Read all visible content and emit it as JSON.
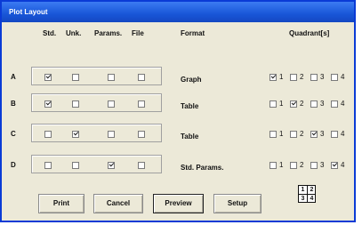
{
  "window": {
    "title": "Plot Layout"
  },
  "headers": {
    "std": "Std.",
    "unk": "Unk.",
    "params": "Params.",
    "file": "File",
    "format": "Format",
    "quadrants": "Quadrant[s]"
  },
  "rows": [
    {
      "label": "A",
      "std": true,
      "unk": false,
      "params": false,
      "file": false,
      "format": "Graph",
      "quadrants": [
        true,
        false,
        false,
        false
      ]
    },
    {
      "label": "B",
      "std": true,
      "unk": false,
      "params": false,
      "file": false,
      "format": "Table",
      "quadrants": [
        false,
        true,
        false,
        false
      ]
    },
    {
      "label": "C",
      "std": false,
      "unk": true,
      "params": false,
      "file": false,
      "format": "Table",
      "quadrants": [
        false,
        false,
        true,
        false
      ]
    },
    {
      "label": "D",
      "std": false,
      "unk": false,
      "params": true,
      "file": false,
      "format": "Std. Params.",
      "quadrants": [
        false,
        false,
        false,
        true
      ]
    }
  ],
  "quadrant_numbers": [
    "1",
    "2",
    "3",
    "4"
  ],
  "buttons": {
    "print": "Print",
    "cancel": "Cancel",
    "preview": "Preview",
    "setup": "Setup"
  },
  "quadrant_map": [
    "1",
    "2",
    "3",
    "4"
  ],
  "colors": {
    "titlebar": "#1856d8",
    "dialog": "#ece9d8"
  }
}
